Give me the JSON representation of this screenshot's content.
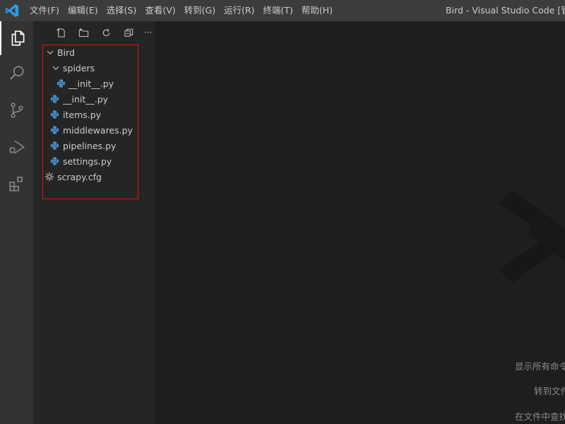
{
  "titlebar": {
    "menu": [
      {
        "label": "文件(F)"
      },
      {
        "label": "编辑(E)"
      },
      {
        "label": "选择(S)"
      },
      {
        "label": "查看(V)"
      },
      {
        "label": "转到(G)"
      },
      {
        "label": "运行(R)"
      },
      {
        "label": "终端(T)"
      },
      {
        "label": "帮助(H)"
      }
    ],
    "window_title": "Bird - Visual Studio Code [管理员]"
  },
  "activity_bar": {
    "items": [
      "explorer-icon",
      "search-icon",
      "source-control-icon",
      "run-debug-icon",
      "extensions-icon"
    ],
    "accent_color": "#ffffff"
  },
  "explorer": {
    "toolbar": [
      "new-file-icon",
      "new-folder-icon",
      "refresh-icon",
      "collapse-all-icon",
      "more-icon"
    ],
    "more_label": "···",
    "tree": [
      {
        "label": "Bird",
        "kind": "folder-open",
        "indent": 0
      },
      {
        "label": "spiders",
        "kind": "folder-open",
        "indent": 1
      },
      {
        "label": "__init__.py",
        "kind": "python",
        "indent": 2
      },
      {
        "label": "__init__.py",
        "kind": "python",
        "indent": 1
      },
      {
        "label": "items.py",
        "kind": "python",
        "indent": 1
      },
      {
        "label": "middlewares.py",
        "kind": "python",
        "indent": 1
      },
      {
        "label": "pipelines.py",
        "kind": "python",
        "indent": 1
      },
      {
        "label": "settings.py",
        "kind": "python",
        "indent": 1
      },
      {
        "label": "scrapy.cfg",
        "kind": "config",
        "indent": 0
      }
    ],
    "highlight_color": "#e51400"
  },
  "editor": {
    "hints": [
      "显示所有命令",
      "转到文件",
      "在文件中查找"
    ]
  }
}
